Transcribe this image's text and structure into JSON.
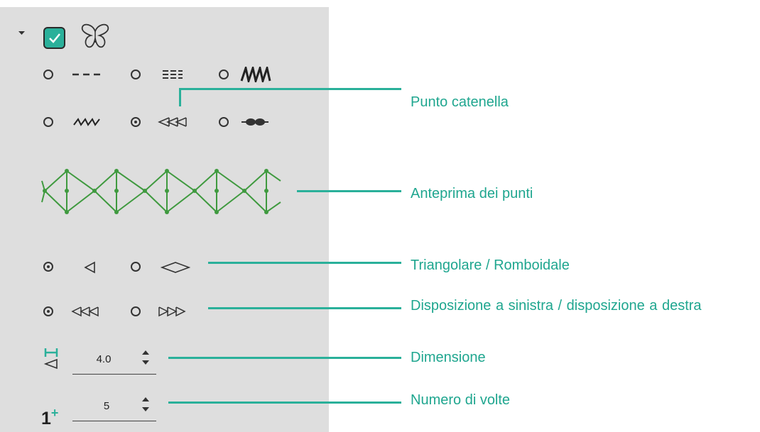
{
  "callouts": {
    "chain_stitch": "Punto catenella",
    "preview": "Anteprima dei punti",
    "shape": "Triangolare / Romboidale",
    "arrangement": "Disposizione a sinistra / disposizione a destra",
    "size": "Dimensione",
    "times": "Numero di volte"
  },
  "panel": {
    "size_value": "4.0",
    "times_value": "5",
    "times_icon_text": "1",
    "times_icon_plus": "+"
  },
  "colors": {
    "accent": "#1fa68f",
    "checkbox": "#2ab09a",
    "preview_stroke": "#3f9a3f",
    "panel_bg": "#dedede"
  }
}
